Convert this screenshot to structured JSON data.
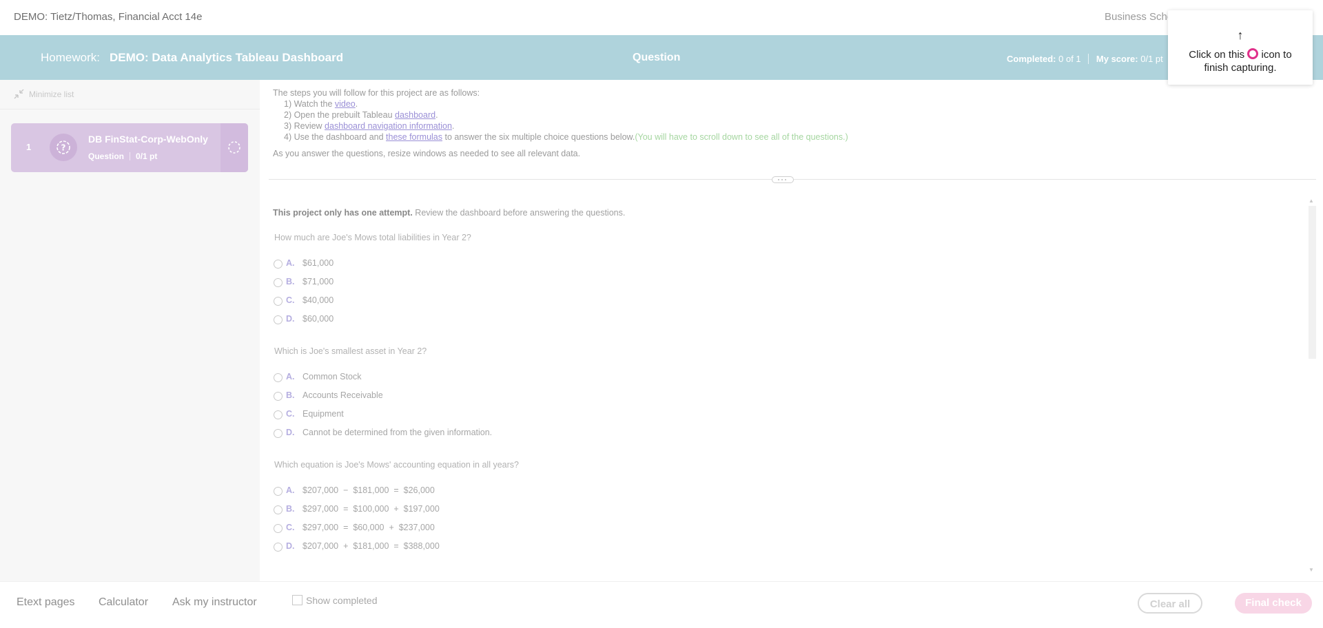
{
  "topbar": {
    "course_title": "DEMO: Tietz/Thomas, Financial Acct 14e",
    "school": "Business Scho"
  },
  "header": {
    "homework_label": "Homework:",
    "homework_title": "DEMO: Data Analytics Tableau Dashboard",
    "center_label": "Question",
    "completed_label": "Completed:",
    "completed_value": "0 of 1",
    "score_label": "My score:",
    "score_value": "0/1 pt"
  },
  "tooltip": {
    "arrow": "↑",
    "text_before": "Click on this",
    "text_after": "icon to finish capturing.",
    "icon": "ring-icon",
    "icon_color": "#e0308a"
  },
  "sidebar": {
    "minimize_label": "Minimize list",
    "question_item": {
      "number": "1",
      "name": "DB FinStat-Corp-WebOnly",
      "type": "Question",
      "points": "0/1 pt"
    }
  },
  "intro": {
    "lead": "The steps you will follow for this project are as follows:",
    "step1_prefix": "1) Watch the ",
    "step1_link": "video",
    "step1_suffix": ".",
    "step2_prefix": "2) Open the prebuilt Tableau ",
    "step2_link": "dashboard",
    "step2_suffix": ".",
    "step3_prefix": "3) Review ",
    "step3_link": "dashboard navigation information",
    "step3_suffix": ".",
    "step4_prefix": "4) Use the dashboard and ",
    "step4_link": "these formulas",
    "step4_suffix": " to answer the six multiple choice questions below.",
    "step4_note": "(You will have to scroll down to see all of the questions.)",
    "resize_note": "As you answer the questions, resize windows as needed to see all relevant data."
  },
  "attempt": {
    "bold": "This project only has one attempt.",
    "rest": " Review the dashboard before answering the questions."
  },
  "questions": [
    {
      "text": "How much are Joe's Mows total liabilities in Year 2?",
      "options": [
        {
          "letter": "A.",
          "text": "$61,000"
        },
        {
          "letter": "B.",
          "text": "$71,000"
        },
        {
          "letter": "C.",
          "text": "$40,000"
        },
        {
          "letter": "D.",
          "text": "$60,000"
        }
      ]
    },
    {
      "text": "Which is Joe's smallest asset in Year 2?",
      "options": [
        {
          "letter": "A.",
          "text": "Common Stock"
        },
        {
          "letter": "B.",
          "text": "Accounts Receivable"
        },
        {
          "letter": "C.",
          "text": "Equipment"
        },
        {
          "letter": "D.",
          "text": "Cannot be determined from the given information."
        }
      ]
    },
    {
      "text": "Which equation is Joe's Mows' accounting equation in all years?",
      "options": [
        {
          "letter": "A.",
          "text": "$207,000  −  $181,000  =  $26,000"
        },
        {
          "letter": "B.",
          "text": "$297,000  =  $100,000  +  $197,000"
        },
        {
          "letter": "C.",
          "text": "$297,000  =  $60,000  +  $237,000"
        },
        {
          "letter": "D.",
          "text": "$207,000  +  $181,000  =  $388,000"
        }
      ]
    }
  ],
  "footer": {
    "etext": "Etext pages",
    "calculator": "Calculator",
    "ask": "Ask my instructor",
    "show_completed": "Show completed",
    "clear_all": "Clear all",
    "final_check": "Final check"
  },
  "colors": {
    "header_bg": "#afd3dc",
    "card_bg": "#d9c6e3",
    "final_check_bg": "#f8d6e6",
    "link": "#9a8fd6",
    "note_green": "#a5d6a0"
  }
}
